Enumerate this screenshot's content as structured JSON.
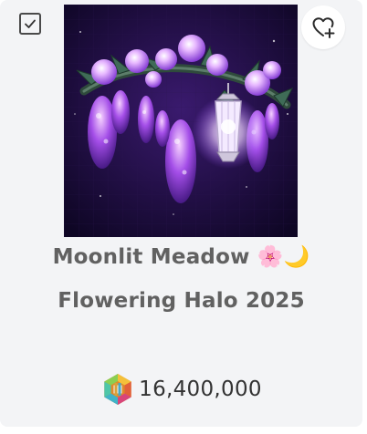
{
  "item": {
    "name_line1": "Moonlit Meadow 🌸🌙",
    "name_line2": "Flowering Halo 2025",
    "price": "16,400,000",
    "image_icon": "purple-wisteria-flower-halo-with-lantern",
    "currency_icon": "robux-currency-icon",
    "selected": true
  },
  "actions": {
    "checkbox_icon": "checkmark-icon",
    "favorite_icon": "heart-plus-icon"
  },
  "colors": {
    "card_background": "#f3f4f6",
    "title_text": "#616161",
    "price_text": "#333333",
    "thumbnail_background": "#12082c",
    "accent_purple": "#a86bff"
  }
}
